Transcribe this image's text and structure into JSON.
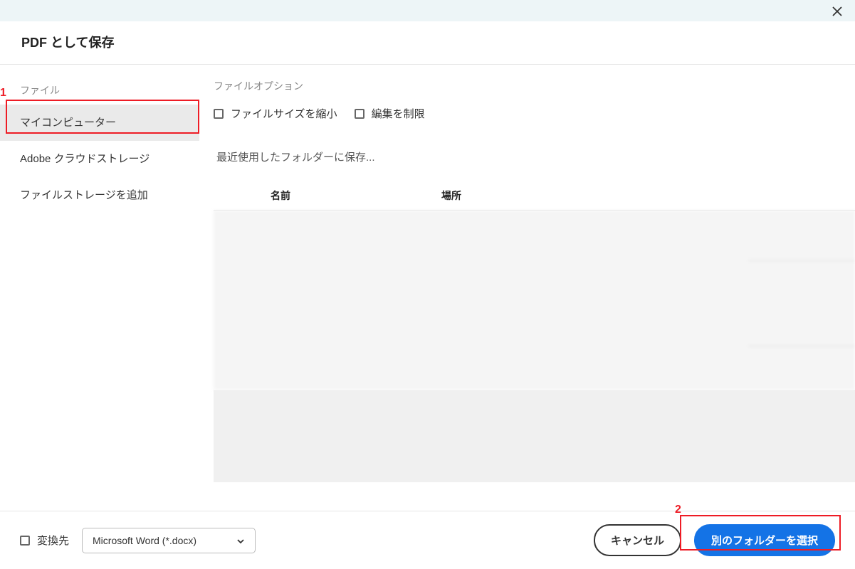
{
  "dialog": {
    "title": "PDF として保存"
  },
  "sidebar": {
    "section_label": "ファイル",
    "items": [
      {
        "label": "マイコンピューター",
        "selected": true
      },
      {
        "label": "Adobe クラウドストレージ",
        "selected": false
      },
      {
        "label": "ファイルストレージを追加",
        "selected": false
      }
    ]
  },
  "options": {
    "section_label": "ファイルオプション",
    "reduce_size_label": "ファイルサイズを縮小",
    "restrict_edit_label": "編集を制限"
  },
  "recent": {
    "label": "最近使用したフォルダーに保存...",
    "columns": {
      "name": "名前",
      "location": "場所"
    }
  },
  "footer": {
    "convert_label": "変換先",
    "format_selected": "Microsoft Word (*.docx)",
    "cancel_label": "キャンセル",
    "choose_folder_label": "別のフォルダーを選択"
  },
  "annotations": {
    "label1": "1",
    "label2": "2"
  }
}
